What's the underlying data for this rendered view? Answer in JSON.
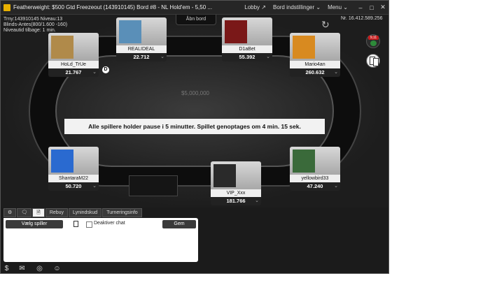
{
  "window": {
    "title": "Featherweight: $500 Gtd Freezeout (143910145) Bord #8 -  NL  Hold'em - 5,50 ...",
    "lobby_label": "Lobby ↗",
    "table_settings_label": "Bord indstillinger ⌄",
    "menu_label": "Menu ⌄",
    "minimize": "–",
    "maximize": "□",
    "close": "✕"
  },
  "tournament": {
    "line1": "Trny:143910145 Niveau:13",
    "line2": "Blinds-Antes(800/1.600 -160)",
    "line3": "Niveautid tilbage: 1 min."
  },
  "open_table_label": "Åbn bord",
  "hand_number": "Nr. 16.412.589.256",
  "pot_text": "$5,000,000",
  "break_message": "Alle spillere holder pause i 5 minutter. Spillet genoptages om    4 min. 15 sek.",
  "players": [
    {
      "name": "HoLd_TrUe",
      "chips": "21.767",
      "avatar_color": "#b08a4a"
    },
    {
      "name": "REALIDEAL",
      "chips": "22.712",
      "avatar_color": "#5a8fb8"
    },
    {
      "name": "D1aBet",
      "chips": "55.392",
      "avatar_color": "#7a1818"
    },
    {
      "name": "Mario4an",
      "chips": "260.632",
      "avatar_color": "#d88a20"
    },
    {
      "name": "ShantaraM22",
      "chips": "50.720",
      "avatar_color": "#2a6ad0"
    },
    {
      "name": "VIP_Xxx",
      "chips": "181.766",
      "avatar_color": "#2a2a2a"
    },
    {
      "name": "yellowbird33",
      "chips": "47.240",
      "avatar_color": "#3a6a3a"
    }
  ],
  "dealer_label": "D",
  "side_buttons": {
    "badge_text": "9,11"
  },
  "chat": {
    "tabs": [
      "⚙",
      "🗨",
      "🗎",
      "Rebuy",
      "Lynindskud",
      "Turneringsinfo"
    ],
    "choose_player_label": "Vælg spiller",
    "disable_chat_label": "Deaktiver chat",
    "save_label": "Gem"
  },
  "bottom_icons": [
    "dollar-icon",
    "mail-icon",
    "globe-icon",
    "people-icon"
  ]
}
